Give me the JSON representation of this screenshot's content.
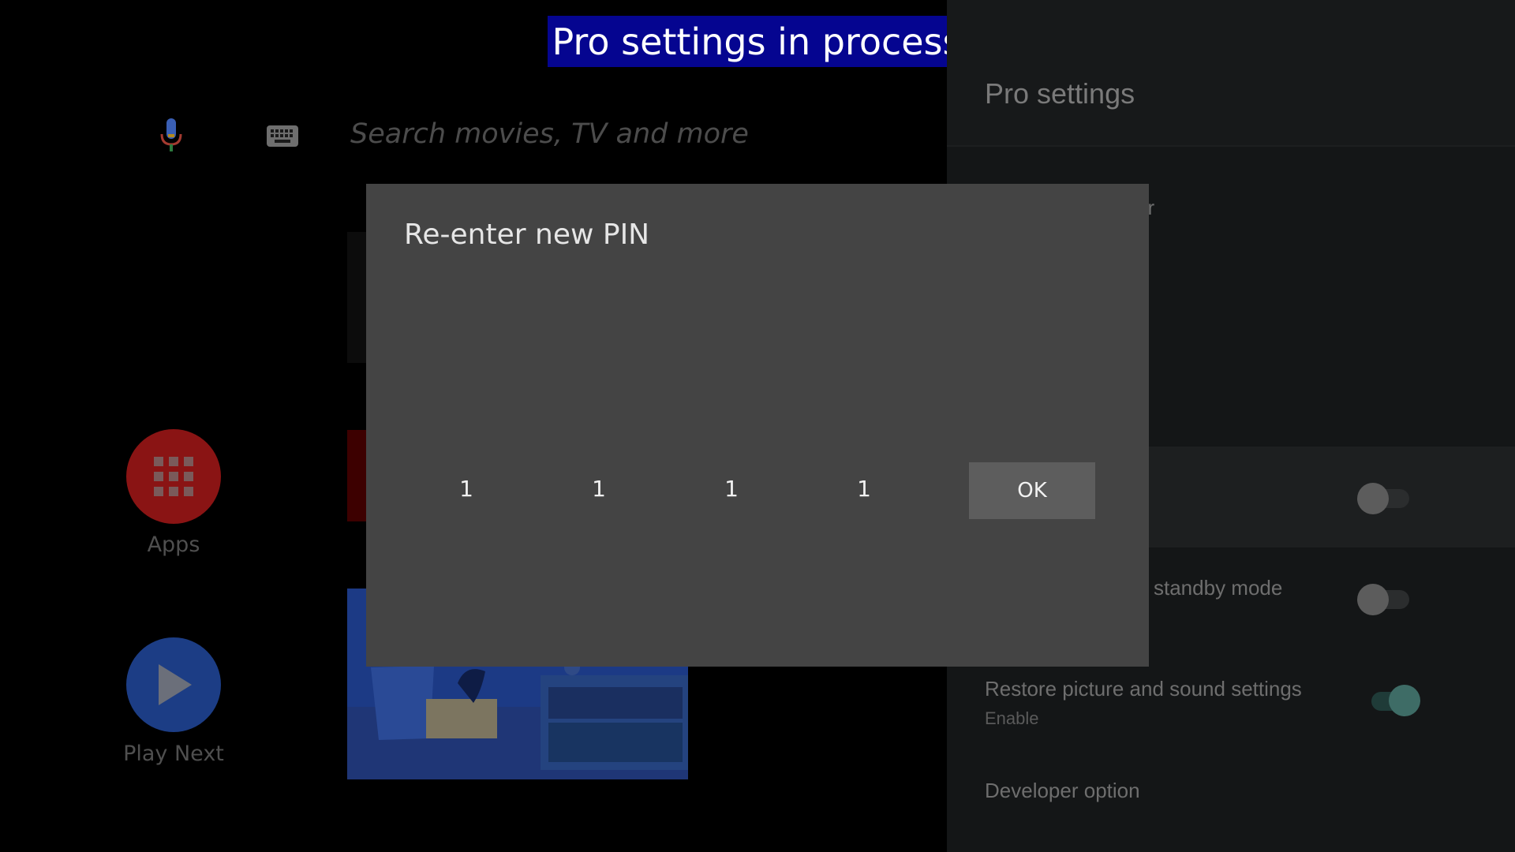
{
  "banner": {
    "text": "Pro settings in process"
  },
  "search": {
    "placeholder": "Search movies, TV and more"
  },
  "home": {
    "apps_label": "Apps",
    "play_next_label": "Play Next"
  },
  "settings": {
    "title": "Pro settings",
    "partial_row_text": "ur",
    "standby_label": "standby mode",
    "restore_label": "Restore picture and sound settings",
    "restore_sub": "Enable",
    "developer_label": "Developer option",
    "toggles": {
      "row1": false,
      "standby": false,
      "restore": true
    }
  },
  "dialog": {
    "title": "Re-enter new PIN",
    "digits": [
      "1",
      "1",
      "1",
      "1"
    ],
    "ok_label": "OK"
  },
  "colors": {
    "banner_bg": "#050590",
    "dialog_bg": "#444444",
    "toggle_on": "#3e6c66"
  }
}
